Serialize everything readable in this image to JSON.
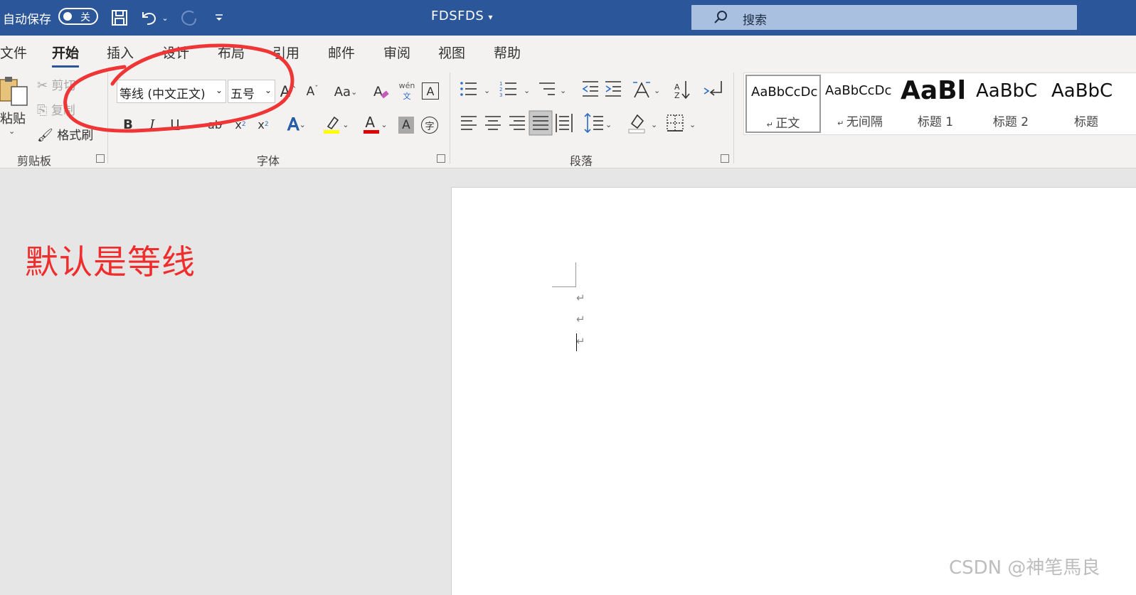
{
  "titlebar": {
    "autosave_label": "自动保存",
    "autosave_state": "关",
    "doc_name": "FDSFDS",
    "search_placeholder": "搜索",
    "colors": {
      "bar": "#2b579a",
      "search": "#aac0e0"
    },
    "icons": [
      "save-icon",
      "undo-icon",
      "redo-icon",
      "customize-qat-icon",
      "search-icon"
    ]
  },
  "tabs": [
    {
      "label": "文件"
    },
    {
      "label": "开始",
      "active": true
    },
    {
      "label": "插入"
    },
    {
      "label": "设计"
    },
    {
      "label": "布局"
    },
    {
      "label": "引用"
    },
    {
      "label": "邮件"
    },
    {
      "label": "审阅"
    },
    {
      "label": "视图"
    },
    {
      "label": "帮助"
    }
  ],
  "clipboard": {
    "paste": "粘贴",
    "cut": "剪切",
    "copy": "复制",
    "format_painter": "格式刷",
    "group_label": "剪贴板"
  },
  "font": {
    "font_name": "等线 (中文正文)",
    "font_size": "五号",
    "group_label": "字体",
    "change_case": "Aa",
    "phonetic_top": "wén",
    "phonetic_bottom": "文",
    "bold": "B",
    "italic": "I",
    "underline": "U",
    "strike": "ab",
    "subscript": "x",
    "subscript_sub": "2",
    "superscript": "x",
    "superscript_sup": "2",
    "text_effects": "A",
    "font_color": "A",
    "char_shading": "A",
    "enclose": "字",
    "highlight_color": "#ffff00",
    "font_color_value": "#e00000"
  },
  "paragraph": {
    "group_label": "段落"
  },
  "styles": [
    {
      "preview": "AaBbCcDc",
      "name": "正文",
      "selected": true
    },
    {
      "preview": "AaBbCcDc",
      "name": "无间隔"
    },
    {
      "preview": "AaBl",
      "name": "标题 1"
    },
    {
      "preview": "AaBbC",
      "name": "标题 2"
    },
    {
      "preview": "AaBbC",
      "name": "标题"
    }
  ],
  "document": {
    "pilcrow": "↵"
  },
  "annotation": {
    "text": "默认是等线",
    "color": "#f02d2d"
  },
  "watermark": "CSDN @神笔馬良"
}
